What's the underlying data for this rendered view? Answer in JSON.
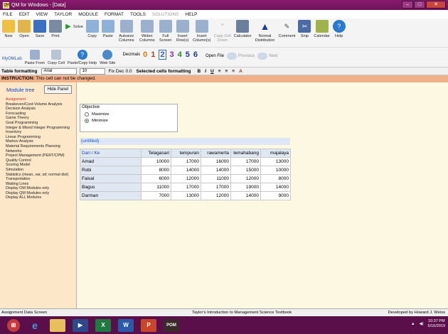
{
  "window": {
    "title": "QM for Windows - [Data]",
    "app_icon": "QM",
    "min": "–",
    "max": "□",
    "close": "✕"
  },
  "menu": [
    "FILE",
    "EDIT",
    "VIEW",
    "TAYLOR",
    "MODULE",
    "FORMAT",
    "TOOLS",
    "SOLUTIONS",
    "HELP"
  ],
  "toolbar": {
    "new": "New",
    "open": "Open",
    "save": "Save",
    "print": "Print",
    "solve": "Solve",
    "copy": "Copy",
    "paste": "Paste",
    "autosize": "Autosize Columns",
    "widen": "Widen Columns",
    "full": "Full Screen",
    "insert_rows": "Insert Row(s)",
    "insert_cols": "Insert Column(s)",
    "copy_cell": "Copy Cell Down",
    "calculator": "Calculator",
    "normal": "Normal Distribution",
    "comment": "Comment",
    "snip": "Snip",
    "calendar": "Calendar",
    "help": "Help"
  },
  "toolbar2": {
    "myomlab": "MyOMLab",
    "paste_from": "Paste From",
    "copy_cell": "Copy Cell",
    "paste_copy_help": "Paste/Copy Help",
    "web_site": "Web Site",
    "decimals_label": "Decimals",
    "decimals": [
      "0",
      "1",
      "2",
      "3",
      "4",
      "5",
      "6"
    ],
    "open_file": "Open File",
    "previous": "Previous",
    "next": "Next"
  },
  "formatbar": {
    "label": "Table formatting",
    "font": "Arial",
    "size": "10",
    "fixdec": "Fix Dec",
    "fixdec_value": "0.0",
    "selected_label": "Selected cells formatting",
    "bold": "B",
    "italic": "I",
    "underline": "U"
  },
  "instruction": {
    "prefix": "INSTRUCTION:",
    "text": "This cell can not be changed."
  },
  "module_tree": {
    "title": "Module tree",
    "hide_button": "Hide Panel",
    "items": [
      "Assignment",
      "Breakeven/Cost-Volume Analysis",
      "Decision Analysis",
      "Forecasting",
      "Game Theory",
      "Goal Programming",
      "Integer & Mixed Integer Programming",
      "Inventory",
      "Linear Programming",
      "Markov Analysis",
      "Material Requirements Planning",
      "Networks",
      "Project Management (PERT/CPM)",
      "Quality Control",
      "Scoring Model",
      "Simulation",
      "Statistics (mean, var, sd; normal dist)",
      "Transportation",
      "Waiting Lines",
      "Display OM Modules only",
      "Display QM Modules only",
      "Display ALL Modules"
    ]
  },
  "objective": {
    "title": "Objective",
    "options": [
      "Maximize",
      "Minimize"
    ],
    "selected": "Minimize"
  },
  "table": {
    "caption": "(untitled)",
    "columns": [
      "Dari / Ke",
      "Telagasari",
      "tempuran",
      "rawamerta",
      "lemahabang",
      "majalaya"
    ],
    "rows": [
      [
        "Amad",
        "10000",
        "17000",
        "16000",
        "17000",
        "13000"
      ],
      [
        "Robi",
        "8000",
        "14000",
        "14000",
        "15000",
        "10000"
      ],
      [
        "Faisal",
        "6000",
        "12000",
        "11000",
        "12000",
        "8000"
      ],
      [
        "Bagus",
        "11000",
        "17000",
        "17000",
        "19000",
        "14000"
      ],
      [
        "Darman",
        "7000",
        "13000",
        "12000",
        "14000",
        "9000"
      ]
    ]
  },
  "status": {
    "left": "Assignment  Data Screen",
    "center": "Taylor's Introduction to Management Science Textbook",
    "right": "Developed by Howard J. Weiss"
  },
  "taskbar": {
    "time": "10:37 PM",
    "date": "5/16/2019"
  }
}
